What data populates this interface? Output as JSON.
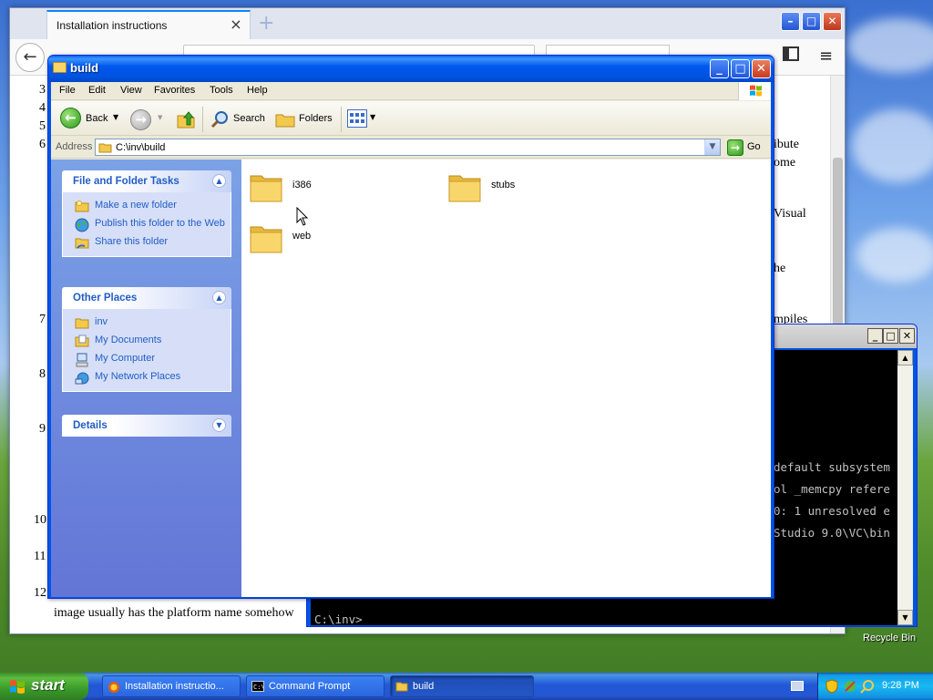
{
  "firefox": {
    "tab_title": "Installation instructions",
    "tab_close": "×",
    "new_tab": "+",
    "min": "–",
    "max": "□",
    "close": "✕",
    "back": "←",
    "menu": "≡",
    "line_numbers": [
      "3",
      "4",
      "5",
      "6",
      "7",
      "8",
      "9",
      "10",
      "11",
      "12"
    ],
    "right_fragments": [
      "ibute",
      "ome",
      "Visual",
      "he",
      "mpiles"
    ],
    "bottom_text": "image usually has the platform name somehow"
  },
  "explorer": {
    "title": "build",
    "buttons": {
      "min": "_",
      "max": "□",
      "close": "✕"
    },
    "menu": [
      "File",
      "Edit",
      "View",
      "Favorites",
      "Tools",
      "Help"
    ],
    "toolbar": {
      "back": "Back",
      "search": "Search",
      "folders": "Folders"
    },
    "address_label": "Address",
    "address_value": "C:\\inv\\build",
    "go": "Go",
    "tasks_panel": {
      "title": "File and Folder Tasks",
      "items": [
        "Make a new folder",
        "Publish this folder to the Web",
        "Share this folder"
      ]
    },
    "places_panel": {
      "title": "Other Places",
      "items": [
        "inv",
        "My Documents",
        "My Computer",
        "My Network Places"
      ]
    },
    "details_panel": {
      "title": "Details"
    },
    "folders": [
      "i386",
      "stubs",
      "web"
    ]
  },
  "cmd": {
    "title": "",
    "lines": [
      "default subsystem",
      "ol _memcpy refere",
      "0: 1 unresolved e",
      "Studio 9.0\\VC\\bin",
      "C:\\inv>"
    ]
  },
  "desktop": {
    "recycle_bin": "Recycle Bin"
  },
  "taskbar": {
    "start": "start",
    "tasks": [
      "Installation instructio...",
      "Command Prompt",
      "build"
    ],
    "clock": "9:28 PM"
  }
}
